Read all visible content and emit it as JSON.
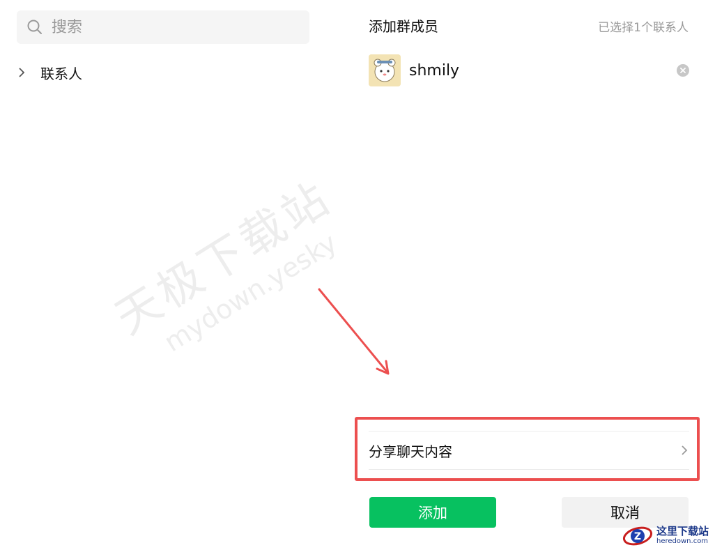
{
  "search": {
    "placeholder": "搜索"
  },
  "tree": {
    "items": [
      {
        "label": "联系人"
      }
    ]
  },
  "watermark": {
    "cn": "天极下载站",
    "en": "mydown.yesky.com"
  },
  "panel": {
    "title": "添加群成员",
    "selected_count": "已选择1个联系人",
    "members": [
      {
        "name": "shmily"
      }
    ],
    "share_label": "分享聊天内容",
    "add_label": "添加",
    "cancel_label": "取消"
  },
  "colors": {
    "primary": "#07c160",
    "highlight": "#ec4f4f",
    "muted": "#9a9a9a"
  },
  "logo": {
    "cn": "这里下载站",
    "en": "heredown.com",
    "letter": "Z"
  },
  "icons": [
    "search-icon",
    "chevron-right-icon",
    "close-circle-icon",
    "avatar",
    "arrow-annotation"
  ]
}
